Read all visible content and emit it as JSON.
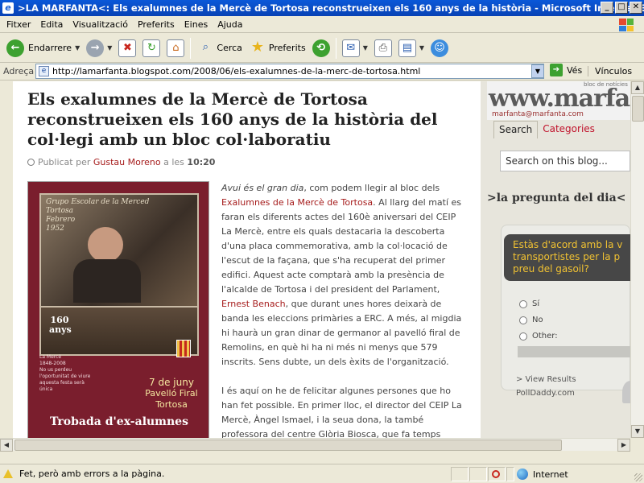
{
  "window": {
    "title": ">LA MARFANTA<: Els exalumnes de la Mercè de Tortosa reconstrueixen els 160 anys de la història - Microsoft Internet Explorer",
    "minimize": "_",
    "maximize": "□",
    "close": "✕"
  },
  "menu": [
    "Fitxer",
    "Edita",
    "Visualització",
    "Preferits",
    "Eines",
    "Ajuda"
  ],
  "toolbar": {
    "back_label": "Endarrere",
    "search_label": "Cerca",
    "favorites_label": "Preferits"
  },
  "address": {
    "label": "Adreça",
    "url": "http://lamarfanta.blogspot.com/2008/06/els-exalumnes-de-la-merc-de-tortosa.html",
    "go_label": "Vés",
    "links_label": "Vínculos"
  },
  "post": {
    "title": "Els exalumnes de la Mercè de Tortosa reconstrueixen els 160 anys de la història del col·legi amb un bloc col·laboratiu",
    "published_by": "Publicat per",
    "author": "Gustau Moreno",
    "at": "a les",
    "time": "10:20"
  },
  "poster": {
    "caption": "Grupo Escolar de la Merced\nTortosa\nFebrero\n1952",
    "anniversary": "160\nanys",
    "merce": "La Mercè\n1848-2008",
    "note": "No us perdeu l'oportunitat de viure aquesta festa serà única",
    "date_line1": "7 de juny",
    "date_line2": "Pavelló Firal",
    "date_line3": "Tortosa",
    "trobada": "Trobada d'ex-alumnes"
  },
  "article": {
    "p1_em": "Avui és el gran dia",
    "p1_a": ", com podem llegir al bloc dels ",
    "p1_link": "Exalumnes de la Mercè de Tortosa",
    "p1_b": ". Al llarg del matí es faran els diferents actes del 160è aniversari del CEIP La Mercè, entre els quals destacaria la descoberta d'una placa commemorativa, amb la col·locació de l'escut de la façana, que s'ha recuperat del primer edifici. Aquest acte comptarà amb la presència de l'alcalde de Tortosa i del president del Parlament, ",
    "p1_link2": "Ernest Benach",
    "p1_c": ", que durant unes hores deixarà de banda les eleccions primàries a ERC. A més, al migdia hi haurà un gran dinar de germanor al pavelló firal de Remolins, en què hi ha ni més ni menys que 579 inscrits. Sens dubte, un dels èxits de l'organització.",
    "p2_a": "I és aquí on he de felicitar algunes persones que ho han fet possible. En primer lloc, el director del CEIP La Mercè, ",
    "p2_link": "Àngel Ismael",
    "p2_b": ", i la seua dona, la també professora del centre Glòria Biosca, que fa temps"
  },
  "sidebar": {
    "logo_tagline": "bloc de notícies",
    "logo_text": "www.marfanta",
    "logo_email": "marfanta@marfanta.com",
    "tab_search": "Search",
    "tab_categories": "Categories",
    "search_placeholder": "Search on this blog...",
    "question_heading": ">la pregunta del dia<",
    "poll_question_line1": "Estàs d'acord amb la v",
    "poll_question_line2": "transportistes per la p",
    "poll_question_line3": "preu del gasoil?",
    "option_1": "Sí",
    "option_2": "No",
    "option_3": "Other:",
    "view_results": "> View Results",
    "polldaddy": "PollDaddy.com"
  },
  "status": {
    "text": "Fet, però amb errors a la pàgina.",
    "zone": "Internet"
  },
  "colors": {
    "link": "#a61c1c",
    "titlebar": "#0a58d8",
    "poster": "#7a1e2d",
    "poll_text": "#f1c232"
  }
}
